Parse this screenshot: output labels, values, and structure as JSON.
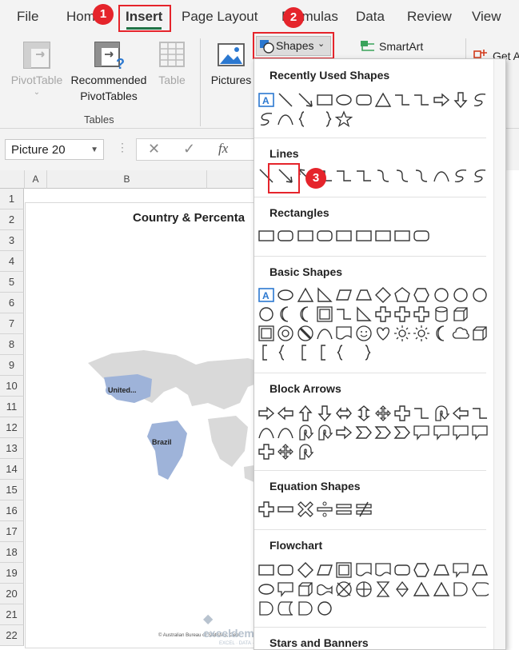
{
  "tabs": [
    {
      "label": "File"
    },
    {
      "label": "Home"
    },
    {
      "label": "Insert"
    },
    {
      "label": "Page Layout"
    },
    {
      "label": "Formulas"
    },
    {
      "label": "Data"
    },
    {
      "label": "Review"
    },
    {
      "label": "View"
    }
  ],
  "ribbon": {
    "pivottable_label": "PivotTable",
    "recommended_label_1": "Recommended",
    "recommended_label_2": "PivotTables",
    "table_label": "Table",
    "tables_group_label": "Tables",
    "pictures_label": "Pictures",
    "shapes_label": "Shapes",
    "smartart_label": "SmartArt",
    "get_addins_label": "Get A"
  },
  "formula_bar": {
    "name_box": "Picture 20",
    "fx_label": "fx"
  },
  "grid": {
    "columns": [
      "A",
      "B"
    ],
    "rows": [
      "1",
      "2",
      "3",
      "4",
      "5",
      "6",
      "7",
      "8",
      "9",
      "10",
      "11",
      "12",
      "13",
      "14",
      "15",
      "16",
      "17",
      "18",
      "19",
      "20",
      "21",
      "22"
    ]
  },
  "chart": {
    "title": "Country & Percenta",
    "labels": [
      "United...",
      "Brazil"
    ],
    "footer": "© Australian Bureau of Statistics, Geo"
  },
  "shapes_menu": {
    "sections": [
      {
        "title": "Recently Used Shapes"
      },
      {
        "title": "Lines"
      },
      {
        "title": "Rectangles"
      },
      {
        "title": "Basic Shapes"
      },
      {
        "title": "Block Arrows"
      },
      {
        "title": "Equation Shapes"
      },
      {
        "title": "Flowchart"
      },
      {
        "title": "Stars and Banners"
      }
    ]
  },
  "badges": [
    "1",
    "2",
    "3"
  ],
  "watermark": "exceldemy",
  "watermark_sub": "EXCEL · DATA · BI",
  "colors": {
    "accent_green": "#217346",
    "badge_red": "#e5242b",
    "map_highlight": "#9eb3d9",
    "map_gray": "#d9d9d9"
  }
}
